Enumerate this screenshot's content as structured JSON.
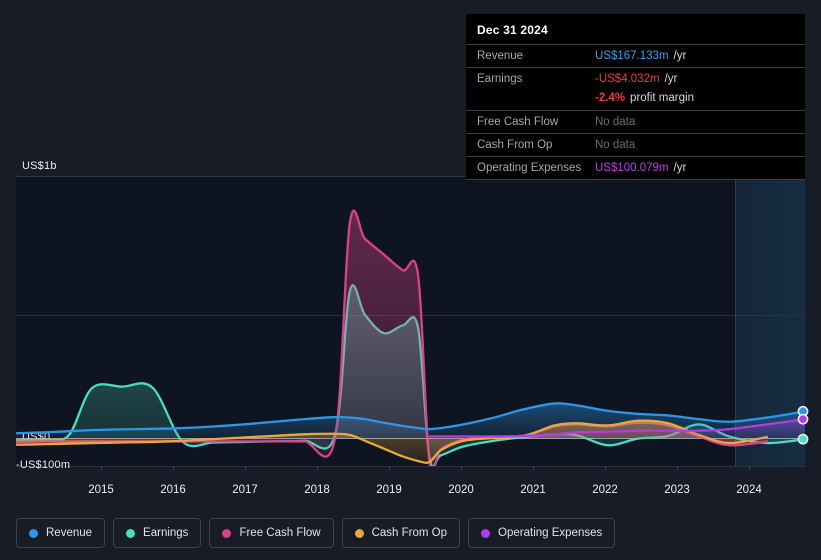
{
  "tooltip": {
    "date": "Dec 31 2024",
    "rows": [
      {
        "label": "Revenue",
        "value": "US$167.133m",
        "unit": "/yr"
      },
      {
        "label": "Earnings",
        "value": "-US$4.032m",
        "unit": "/yr"
      },
      {
        "label": "",
        "value": "-2.4%",
        "unit": "profit margin"
      },
      {
        "label": "Free Cash Flow",
        "value": "No data",
        "unit": ""
      },
      {
        "label": "Cash From Op",
        "value": "No data",
        "unit": ""
      },
      {
        "label": "Operating Expenses",
        "value": "US$100.079m",
        "unit": "/yr"
      }
    ]
  },
  "legend": [
    {
      "label": "Revenue",
      "color": "#2e96e8"
    },
    {
      "label": "Earnings",
      "color": "#4ddcc0"
    },
    {
      "label": "Free Cash Flow",
      "color": "#d6438a"
    },
    {
      "label": "Cash From Op",
      "color": "#e8a83d"
    },
    {
      "label": "Operating Expenses",
      "color": "#b23ce0"
    }
  ],
  "axis": {
    "y_labels": [
      "US$1b",
      "US$0",
      "-US$100m"
    ],
    "x_labels": [
      "2015",
      "2016",
      "2017",
      "2018",
      "2019",
      "2020",
      "2021",
      "2022",
      "2023",
      "2024"
    ]
  },
  "chart_data": {
    "type": "area",
    "title": "",
    "xlabel": "",
    "ylabel": "",
    "ylim": [
      -100,
      1000
    ],
    "y_unit": "US$ millions",
    "grid": true,
    "legend_position": "bottom",
    "forecast_start": "2024.0",
    "x": [
      2014.6,
      2015.0,
      2015.3,
      2015.6,
      2016.0,
      2016.4,
      2016.8,
      2017.2,
      2017.6,
      2018.0,
      2018.4,
      2018.8,
      2019.0,
      2019.2,
      2019.45,
      2019.7,
      2019.9,
      2020.05,
      2020.2,
      2020.5,
      2020.9,
      2021.3,
      2021.7,
      2022.0,
      2022.4,
      2022.8,
      2023.2,
      2023.6,
      2024.0,
      2024.5,
      2025.0
    ],
    "series": [
      {
        "name": "Revenue",
        "color": "#2e96e8",
        "values": [
          18,
          22,
          26,
          30,
          33,
          35,
          38,
          44,
          52,
          62,
          72,
          80,
          78,
          72,
          58,
          46,
          38,
          34,
          38,
          52,
          78,
          110,
          132,
          124,
          104,
          92,
          86,
          72,
          62,
          78,
          102
        ]
      },
      {
        "name": "Earnings",
        "color": "#4ddcc0",
        "values": [
          -8,
          -6,
          12,
          190,
          196,
          192,
          -14,
          -16,
          -14,
          -12,
          -10,
          6,
          560,
          470,
          400,
          430,
          420,
          -70,
          -62,
          -30,
          -10,
          4,
          14,
          10,
          -26,
          -2,
          8,
          52,
          6,
          -18,
          -4
        ]
      },
      {
        "name": "Free Cash Flow",
        "color": "#d6438a",
        "values": [
          -14,
          -12,
          -12,
          -12,
          -12,
          -12,
          -12,
          -12,
          -12,
          -12,
          -12,
          -8,
          820,
          760,
          700,
          640,
          620,
          -86,
          -40,
          -6,
          4,
          10,
          44,
          52,
          44,
          58,
          48,
          6,
          -26,
          -12,
          null
        ]
      },
      {
        "name": "Cash From Op",
        "color": "#e8a83d",
        "values": [
          -24,
          -22,
          -20,
          -18,
          -16,
          -14,
          -10,
          -4,
          2,
          8,
          14,
          16,
          12,
          -10,
          -38,
          -66,
          -82,
          -86,
          -44,
          -10,
          0,
          8,
          48,
          56,
          48,
          66,
          56,
          12,
          -18,
          4,
          null
        ]
      },
      {
        "name": "Operating Expenses",
        "color": "#b23ce0",
        "values": [
          null,
          null,
          null,
          null,
          null,
          null,
          null,
          null,
          null,
          null,
          null,
          null,
          null,
          null,
          null,
          null,
          null,
          6,
          6,
          6,
          6,
          8,
          14,
          22,
          24,
          28,
          28,
          28,
          34,
          52,
          72
        ]
      }
    ]
  }
}
